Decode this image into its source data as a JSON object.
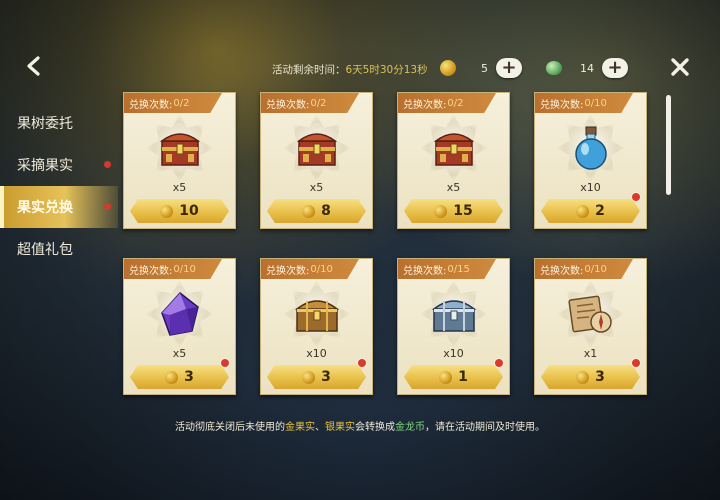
{
  "nav": {
    "back_icon": "arrow-left-icon",
    "close_icon": "close-x-icon"
  },
  "topbar": {
    "remaining_label": "活动剩余时间：",
    "remaining_time": "6天5时30分13秒"
  },
  "currencies": [
    {
      "icon": "gold-fruit-icon",
      "amount": "5"
    },
    {
      "icon": "silver-fruit-icon",
      "amount": "14"
    }
  ],
  "sidebar": {
    "items": [
      {
        "label": "果树委托",
        "active": false,
        "dot": false
      },
      {
        "label": "采摘果实",
        "active": false,
        "dot": true
      },
      {
        "label": "果实兑换",
        "active": true,
        "dot": true
      },
      {
        "label": "超值礼包",
        "active": false,
        "dot": false
      }
    ]
  },
  "shop": {
    "exchange_label": "兑换次数:",
    "items": [
      {
        "icon": "red-treasure-chest-icon",
        "count": "0/2",
        "qty": "x5",
        "price": "10",
        "dot": false
      },
      {
        "icon": "red-treasure-chest-icon",
        "count": "0/2",
        "qty": "x5",
        "price": "8",
        "dot": false
      },
      {
        "icon": "red-treasure-chest-icon",
        "count": "0/2",
        "qty": "x5",
        "price": "15",
        "dot": false
      },
      {
        "icon": "blue-potion-icon",
        "count": "0/10",
        "qty": "x10",
        "price": "2",
        "dot": true
      },
      {
        "icon": "purple-crystal-icon",
        "count": "0/10",
        "qty": "x5",
        "price": "3",
        "dot": true
      },
      {
        "icon": "golden-chest-icon",
        "count": "0/10",
        "qty": "x10",
        "price": "3",
        "dot": true
      },
      {
        "icon": "silver-chest-icon",
        "count": "0/15",
        "qty": "x10",
        "price": "1",
        "dot": true
      },
      {
        "icon": "map-compass-icon",
        "count": "0/10",
        "qty": "x1",
        "price": "3",
        "dot": true
      }
    ]
  },
  "footer": {
    "part1": "活动彻底关闭后未使用的",
    "gold_fruit": "金果实",
    "comma": "、",
    "silver_fruit": "银果实",
    "part2": "会转换成",
    "gold_dragon": "金龙币",
    "part3": "，请在活动期间及时使用。"
  },
  "colors": {
    "accent_gold": "#e7c25a",
    "tab_orange": "#cf8a3e",
    "badge_red": "#d93a2c"
  }
}
